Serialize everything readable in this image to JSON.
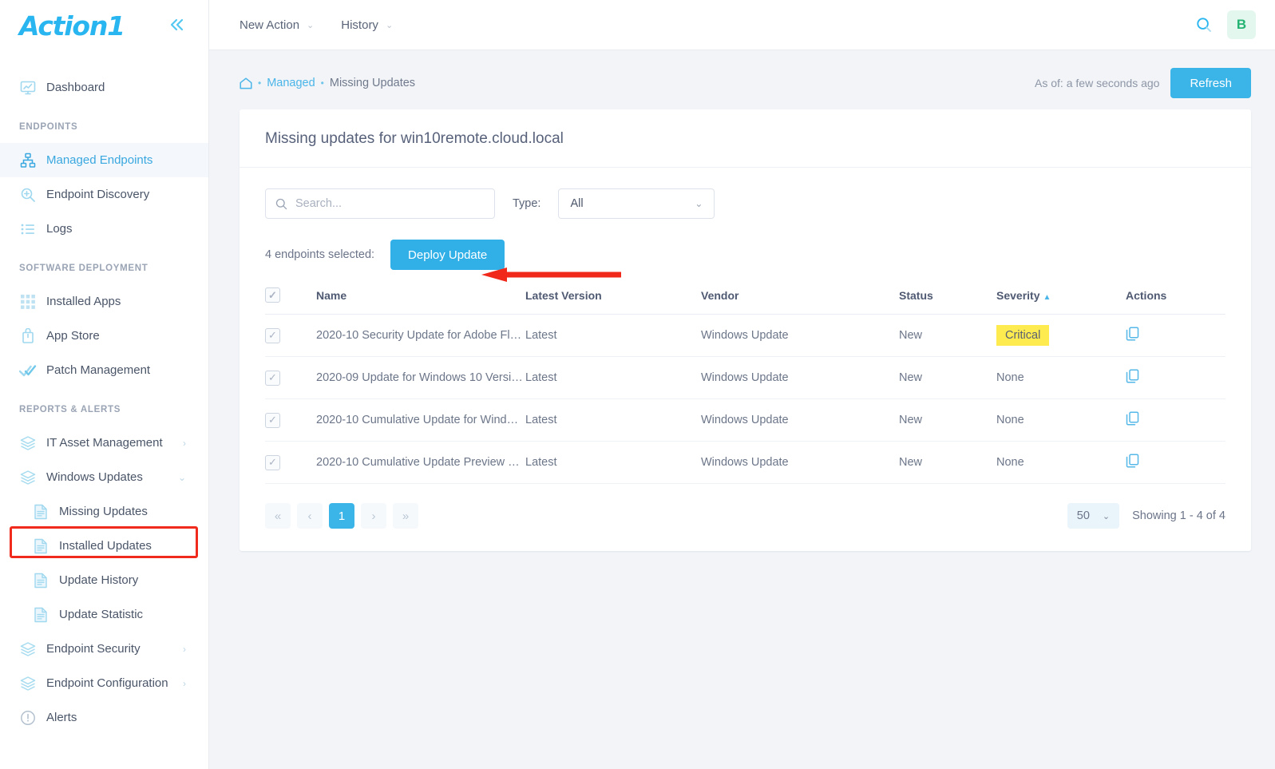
{
  "brand": {
    "name": "Action1",
    "collapse_icon": "chevron-double-left-icon"
  },
  "sidebar": {
    "groups": [
      {
        "label": "",
        "items": [
          {
            "label": "Dashboard",
            "icon": "monitor-chart-icon",
            "active": false,
            "sub": false,
            "chevron": ""
          }
        ]
      },
      {
        "label": "ENDPOINTS",
        "items": [
          {
            "label": "Managed Endpoints",
            "icon": "sitemap-icon",
            "active": true,
            "sub": false,
            "chevron": ""
          },
          {
            "label": "Endpoint Discovery",
            "icon": "magnifier-plus-icon",
            "active": false,
            "sub": false,
            "chevron": ""
          },
          {
            "label": "Logs",
            "icon": "list-icon",
            "active": false,
            "sub": false,
            "chevron": ""
          }
        ]
      },
      {
        "label": "SOFTWARE DEPLOYMENT",
        "items": [
          {
            "label": "Installed Apps",
            "icon": "grid-icon",
            "active": false,
            "sub": false,
            "chevron": ""
          },
          {
            "label": "App Store",
            "icon": "bag-icon",
            "active": false,
            "sub": false,
            "chevron": ""
          },
          {
            "label": "Patch Management",
            "icon": "double-check-icon",
            "active": false,
            "sub": false,
            "chevron": ""
          }
        ]
      },
      {
        "label": "REPORTS & ALERTS",
        "items": [
          {
            "label": "IT Asset Management",
            "icon": "layers-icon",
            "active": false,
            "sub": false,
            "chevron": "right"
          },
          {
            "label": "Windows Updates",
            "icon": "layers-icon",
            "active": false,
            "sub": false,
            "chevron": "down"
          },
          {
            "label": "Missing Updates",
            "icon": "document-icon",
            "active": false,
            "sub": true,
            "chevron": ""
          },
          {
            "label": "Installed Updates",
            "icon": "document-icon",
            "active": false,
            "sub": true,
            "chevron": ""
          },
          {
            "label": "Update History",
            "icon": "document-icon",
            "active": false,
            "sub": true,
            "chevron": ""
          },
          {
            "label": "Update Statistic",
            "icon": "document-icon",
            "active": false,
            "sub": true,
            "chevron": ""
          },
          {
            "label": "Endpoint Security",
            "icon": "layers-icon",
            "active": false,
            "sub": false,
            "chevron": "right"
          },
          {
            "label": "Endpoint Configuration",
            "icon": "layers-icon",
            "active": false,
            "sub": false,
            "chevron": "right"
          },
          {
            "label": "Alerts",
            "icon": "alert-circle-icon",
            "active": false,
            "sub": false,
            "chevron": ""
          }
        ]
      }
    ],
    "highlight_item": "Missing Updates",
    "highlight_color": "#f02b1d"
  },
  "topbar": {
    "menu": [
      {
        "label": "New Action",
        "caret": "chevron-down-icon"
      },
      {
        "label": "History",
        "caret": "chevron-down-icon"
      }
    ],
    "search_icon": "search-icon",
    "avatar_initial": "B",
    "avatar_color": "#25b373"
  },
  "breadcrumb": {
    "home_icon": "home-icon",
    "separator": "•",
    "managed": "Managed",
    "current": "Missing Updates"
  },
  "header_actions": {
    "as_of": "As of: a few seconds ago",
    "refresh_label": "Refresh",
    "refresh_color": "#3bb4e8"
  },
  "card": {
    "title": "Missing updates for win10remote.cloud.local",
    "search": {
      "placeholder": "Search...",
      "value": "",
      "icon": "search-icon"
    },
    "type_filter": {
      "label": "Type:",
      "value": "All",
      "caret": "chevron-down-icon"
    },
    "selection": {
      "count_text": "4 endpoints selected:",
      "deploy_label": "Deploy Update"
    },
    "columns": [
      "Name",
      "Latest Version",
      "Vendor",
      "Status",
      "Severity",
      "Actions"
    ],
    "sorted_column": "Severity",
    "sort_direction": "asc",
    "rows": [
      {
        "checked": true,
        "name": "2020-10 Security Update for Adobe Fl…",
        "version": "Latest",
        "vendor": "Windows Update",
        "status": "New",
        "severity": "Critical",
        "severity_highlight": true,
        "action_icon": "copy-icon"
      },
      {
        "checked": true,
        "name": "2020-09 Update for Windows 10 Versi…",
        "version": "Latest",
        "vendor": "Windows Update",
        "status": "New",
        "severity": "None",
        "severity_highlight": false,
        "action_icon": "copy-icon"
      },
      {
        "checked": true,
        "name": "2020-10 Cumulative Update for Wind…",
        "version": "Latest",
        "vendor": "Windows Update",
        "status": "New",
        "severity": "None",
        "severity_highlight": false,
        "action_icon": "copy-icon"
      },
      {
        "checked": true,
        "name": "2020-10 Cumulative Update Preview …",
        "version": "Latest",
        "vendor": "Windows Update",
        "status": "New",
        "severity": "None",
        "severity_highlight": false,
        "action_icon": "copy-icon"
      }
    ],
    "pagination": {
      "first": "«",
      "prev": "‹",
      "pages": [
        "1"
      ],
      "current_page": "1",
      "next": "›",
      "last": "»",
      "page_size": "50",
      "page_size_caret": "chevron-down-icon",
      "showing": "Showing 1 - 4 of 4"
    }
  },
  "annotations": {
    "arrow_color": "#f02b1d",
    "arrow_target": "Deploy Update",
    "highlight_target": "Missing Updates"
  }
}
